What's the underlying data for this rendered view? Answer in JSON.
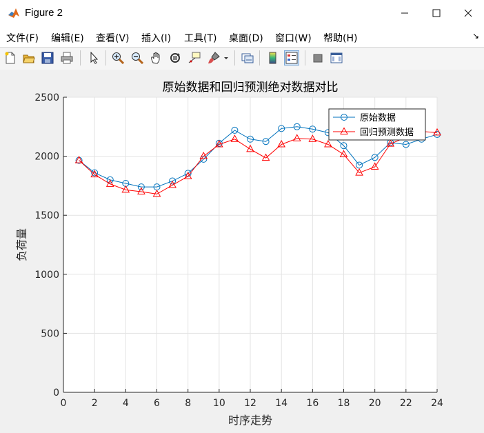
{
  "window": {
    "title": "Figure 2",
    "minimize": "—",
    "maximize": "☐",
    "close": "✕"
  },
  "menu": [
    "文件(F)",
    "编辑(E)",
    "查看(V)",
    "插入(I)",
    "工具(T)",
    "桌面(D)",
    "窗口(W)",
    "帮助(H)"
  ],
  "menu_more": "↘",
  "toolbar": [
    {
      "name": "new-figure-icon"
    },
    {
      "name": "open-file-icon"
    },
    {
      "name": "save-icon"
    },
    {
      "name": "print-icon"
    },
    {
      "name": "pointer-icon"
    },
    {
      "name": "zoom-in-icon"
    },
    {
      "name": "zoom-out-icon"
    },
    {
      "name": "pan-icon"
    },
    {
      "name": "rotate-3d-icon"
    },
    {
      "name": "data-cursor-icon"
    },
    {
      "name": "brush-icon"
    },
    {
      "name": "dropdown-arrow-icon"
    },
    {
      "name": "link-plot-icon"
    },
    {
      "name": "colorbar-icon"
    },
    {
      "name": "legend-icon"
    },
    {
      "name": "hide-plot-tools-icon"
    },
    {
      "name": "show-plot-tools-icon"
    }
  ],
  "colors": {
    "original": "#0072bd",
    "regression": "#ff0000",
    "axes_bg": "#ffffff",
    "figure_bg": "#f0f0f0"
  },
  "chart_data": {
    "type": "line",
    "title": "原始数据和回归预测绝对数据对比",
    "xlabel": "时序走势",
    "ylabel": "负荷量",
    "xlim": [
      0,
      24
    ],
    "ylim": [
      0,
      2500
    ],
    "xticks": [
      0,
      2,
      4,
      6,
      8,
      10,
      12,
      14,
      16,
      18,
      20,
      22,
      24
    ],
    "yticks": [
      0,
      500,
      1000,
      1500,
      2000,
      2500
    ],
    "grid": true,
    "legend_position": "top-right",
    "x": [
      1,
      2,
      3,
      4,
      5,
      6,
      7,
      8,
      9,
      10,
      11,
      12,
      13,
      14,
      15,
      16,
      17,
      18,
      19,
      20,
      21,
      22,
      23,
      24
    ],
    "series": [
      {
        "name": "原始数据",
        "marker": "circle",
        "color": "#0072bd",
        "values": [
          1965,
          1860,
          1800,
          1770,
          1740,
          1740,
          1790,
          1855,
          1975,
          2110,
          2220,
          2145,
          2125,
          2235,
          2250,
          2230,
          2200,
          2090,
          1925,
          1990,
          2115,
          2100,
          2145,
          2185
        ]
      },
      {
        "name": "回归预测数据",
        "marker": "triangle",
        "color": "#ff0000",
        "values": [
          1965,
          1845,
          1765,
          1715,
          1700,
          1680,
          1755,
          1830,
          2000,
          2100,
          2145,
          2060,
          1985,
          2100,
          2150,
          2145,
          2100,
          2015,
          1860,
          1910,
          2105,
          2160,
          2210,
          2200
        ]
      }
    ]
  }
}
